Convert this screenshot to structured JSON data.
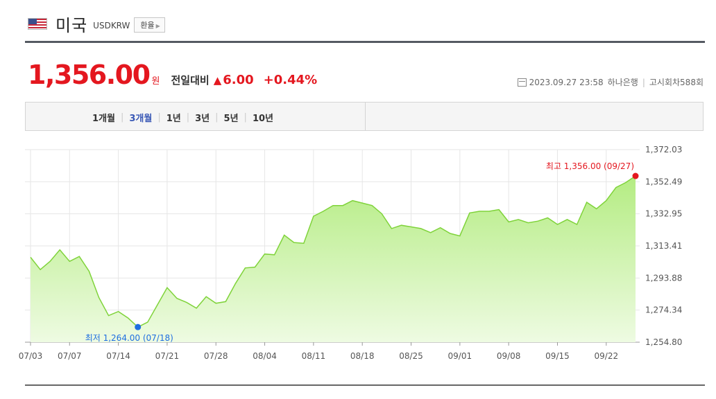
{
  "header": {
    "name": "미국",
    "code": "USDKRW",
    "exchange_button": "환율",
    "flag_icon": "us-flag-icon"
  },
  "price": {
    "value": "1,356.00",
    "unit": "원",
    "label": "전일대비",
    "direction_icon": "up-triangle-icon",
    "direction_symbol": "▲",
    "change": "6.00",
    "change_pct": "+0.44%"
  },
  "meta": {
    "datetime": "2023.09.27 23:58",
    "bank": "하나은행",
    "notice": "고시회차588회"
  },
  "tabs": [
    {
      "label": "1개월",
      "active": false
    },
    {
      "label": "3개월",
      "active": true
    },
    {
      "label": "1년",
      "active": false
    },
    {
      "label": "3년",
      "active": false
    },
    {
      "label": "5년",
      "active": false
    },
    {
      "label": "10년",
      "active": false
    }
  ],
  "colors": {
    "accent_red": "#e4171f",
    "active_tab": "#3857b5",
    "low_dot": "#1f6fe0",
    "line": "#7fd33a",
    "fill_top": "#b4ec82",
    "fill_bottom": "#eefbe2"
  },
  "chart_data": {
    "type": "area",
    "x": [
      "07/03",
      "07/04",
      "07/05",
      "07/06",
      "07/07",
      "07/10",
      "07/11",
      "07/12",
      "07/13",
      "07/14",
      "07/17",
      "07/18",
      "07/19",
      "07/20",
      "07/21",
      "07/24",
      "07/25",
      "07/26",
      "07/27",
      "07/28",
      "07/31",
      "08/01",
      "08/02",
      "08/03",
      "08/04",
      "08/07",
      "08/08",
      "08/09",
      "08/10",
      "08/11",
      "08/14",
      "08/15",
      "08/16",
      "08/17",
      "08/18",
      "08/21",
      "08/22",
      "08/23",
      "08/24",
      "08/25",
      "08/28",
      "08/29",
      "08/30",
      "08/31",
      "09/01",
      "09/04",
      "09/05",
      "09/06",
      "09/07",
      "09/08",
      "09/11",
      "09/12",
      "09/13",
      "09/14",
      "09/15",
      "09/18",
      "09/19",
      "09/20",
      "09/21",
      "09/22",
      "09/25",
      "09/26",
      "09/27"
    ],
    "values": [
      1306.5,
      1299.0,
      1304.0,
      1311.0,
      1304.0,
      1307.0,
      1298.0,
      1282.0,
      1271.0,
      1273.5,
      1269.5,
      1264.0,
      1267.0,
      1277.5,
      1288.0,
      1281.5,
      1279.0,
      1275.5,
      1282.5,
      1278.5,
      1279.5,
      1290.5,
      1300.0,
      1300.5,
      1308.5,
      1308.0,
      1320.0,
      1315.5,
      1315.0,
      1331.5,
      1334.5,
      1338.0,
      1338.0,
      1341.0,
      1339.5,
      1338.0,
      1333.0,
      1324.0,
      1326.0,
      1325.0,
      1324.0,
      1321.5,
      1324.5,
      1321.0,
      1319.5,
      1333.5,
      1334.5,
      1334.5,
      1335.5,
      1328.0,
      1329.5,
      1327.5,
      1328.5,
      1330.5,
      1326.5,
      1329.5,
      1326.5,
      1340.0,
      1336.0,
      1341.0,
      1349.0,
      1352.0,
      1356.0
    ],
    "x_ticks": [
      "07/03",
      "07/07",
      "07/14",
      "07/21",
      "07/28",
      "08/04",
      "08/11",
      "08/18",
      "08/25",
      "09/01",
      "09/08",
      "09/15",
      "09/22"
    ],
    "y_ticks": [
      "1,372.03",
      "1,352.49",
      "1,332.95",
      "1,313.41",
      "1,293.88",
      "1,274.34",
      "1,254.80"
    ],
    "ylim": [
      1254.8,
      1372.03
    ],
    "grid": true,
    "max_label": "최고 1,356.00 (09/27)",
    "min_label": "최저 1,264.00 (07/18)"
  }
}
